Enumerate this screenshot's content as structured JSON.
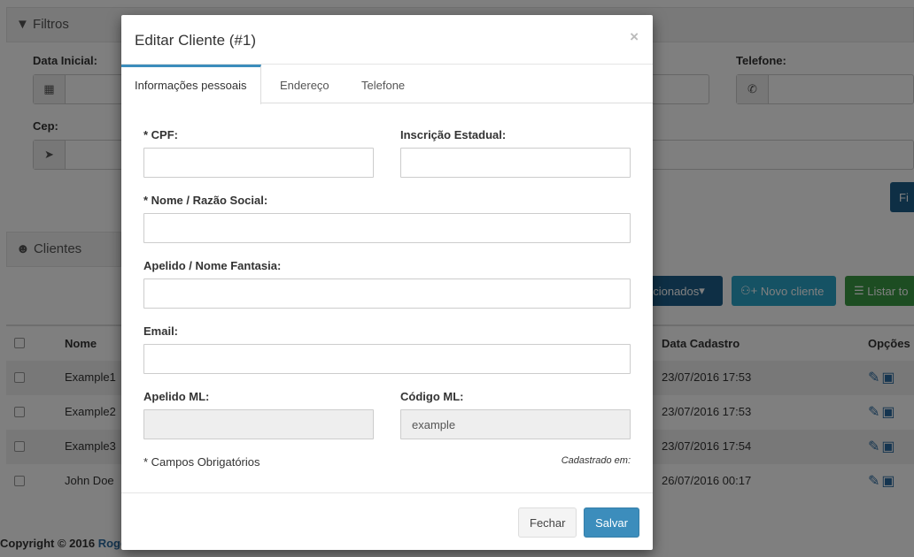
{
  "background": {
    "filters": {
      "title": "Filtros",
      "fields": {
        "data_inicial": "Data Inicial:",
        "telefone": "Telefone:",
        "cep": "Cep:"
      },
      "filter_button": "Fi"
    },
    "clients": {
      "title": "Clientes",
      "buttons": {
        "selected_label": "ecionados",
        "new_client_label": "Novo cliente",
        "list_all_label": "Listar to"
      },
      "columns": {
        "name": "Nome",
        "date": "Data Cadastro",
        "options": "Opções"
      },
      "rows": [
        {
          "name": "Example1",
          "date": "23/07/2016 17:53"
        },
        {
          "name": "Example2",
          "date": "23/07/2016 17:53"
        },
        {
          "name": "Example3",
          "date": "23/07/2016 17:54"
        },
        {
          "name": "John Doe",
          "date": "26/07/2016 00:17"
        }
      ]
    },
    "footer": {
      "copyright": "Copyright © 2016 ",
      "link": "Roge"
    }
  },
  "modal": {
    "title": "Editar Cliente (#1)",
    "close_symbol": "×",
    "tabs": [
      {
        "label": "Informações pessoais",
        "active": true
      },
      {
        "label": "Endereço",
        "active": false
      },
      {
        "label": "Telefone",
        "active": false
      }
    ],
    "fields": {
      "cpf": {
        "label": "* CPF:",
        "value": ""
      },
      "inscricao": {
        "label": "Inscrição Estadual:",
        "value": ""
      },
      "nome": {
        "label": "* Nome / Razão Social:",
        "value": ""
      },
      "apelido": {
        "label": "Apelido / Nome Fantasia:",
        "value": ""
      },
      "email": {
        "label": "Email:",
        "value": ""
      },
      "apelido_ml": {
        "label": "Apelido ML:",
        "value": ""
      },
      "codigo_ml": {
        "label": "Código ML:",
        "value": "example"
      }
    },
    "required_note": "* Campos Obrigatórios",
    "registered_at": "Cadastrado em:",
    "buttons": {
      "close": "Fechar",
      "save": "Salvar"
    }
  },
  "colors": {
    "primary": "#3c8dbc",
    "info": "#2aa4c8",
    "success": "#3a9b44",
    "overlay": "rgba(0,0,0,0.5)"
  }
}
